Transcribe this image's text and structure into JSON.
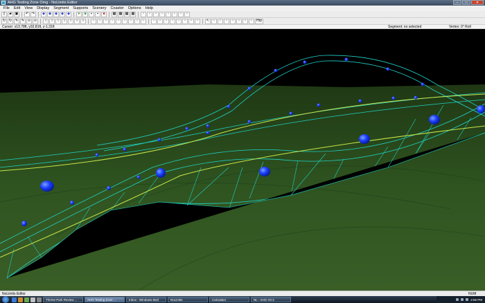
{
  "window": {
    "title": "AHG Testing Zone Omg - NoLimits Editor"
  },
  "menu": [
    "File",
    "Edit",
    "View",
    "Display",
    "Segment",
    "Supports",
    "Scenery",
    "Coaster",
    "Options",
    "Help"
  ],
  "toolbar1_icons": [
    "new-icon",
    "open-icon",
    "save-icon",
    "undo-icon",
    "redo-icon",
    "blue-track-icon",
    "blue-track-icon",
    "blue-track-icon",
    "blue-track-icon",
    "blue-track-icon",
    "arrow-icon",
    "green-icon",
    "gray-icon",
    "gray-icon",
    "red-icon",
    "grid-icon",
    "grid-icon",
    "grid-icon",
    "grid-icon",
    "tool-icon",
    "tool-icon",
    "tool-icon",
    "tool-icon",
    "tool-icon",
    "tool-icon",
    "tool-icon",
    "tool-icon"
  ],
  "toolbar2_icons": [
    "rotate-icon",
    "rotate-icon",
    "pen-icon",
    "pen-icon",
    "link-icon",
    "link-icon",
    "circle-icon",
    "circle-icon",
    "circle-icon",
    "circle-icon",
    "circle-icon",
    "circle-icon",
    "circle-icon",
    "tool-icon",
    "tool-icon",
    "tool-icon",
    "tool-icon",
    "tool-icon",
    "tool-icon",
    "tool-icon",
    "tool-icon",
    "tool-icon",
    "tool-icon",
    "tool-icon",
    "tool-icon",
    "tool-icon",
    "tool-icon",
    "tool-icon",
    "tool-icon",
    "tool-icon",
    "cursor-icon",
    "tool-icon",
    "tool-icon",
    "tool-icon",
    "tool-icon",
    "tool-icon",
    "tool-icon",
    "tool-icon"
  ],
  "toolbar2_label": "Hrp",
  "coords": {
    "cursor": "Cursor: x13.78ft, y32.81ft, z-1.31ft",
    "segment": "Segment: no selected",
    "vertex": "Vertex: 0° Roll"
  },
  "status": {
    "ready": "NoLimits Editor",
    "num": "NUM"
  },
  "taskbar": {
    "tasks": [
      {
        "label": "Theme Park Review ...",
        "active": false
      },
      {
        "label": "AHG Testing Zone ...",
        "active": true
      },
      {
        "label": "Inbox - Windows Mail",
        "active": false
      },
      {
        "label": "NoLimits",
        "active": false
      },
      {
        "label": "Calculator",
        "active": false
      },
      {
        "label": "NL - AHG V0.3",
        "active": false
      }
    ],
    "clock": "2:55 PM"
  },
  "colors": {
    "sky": "#000000",
    "ground": "#2e4f1d",
    "wireframe": "#1fd4c8",
    "rail": "#c8e64a",
    "node": "#1540ff"
  }
}
